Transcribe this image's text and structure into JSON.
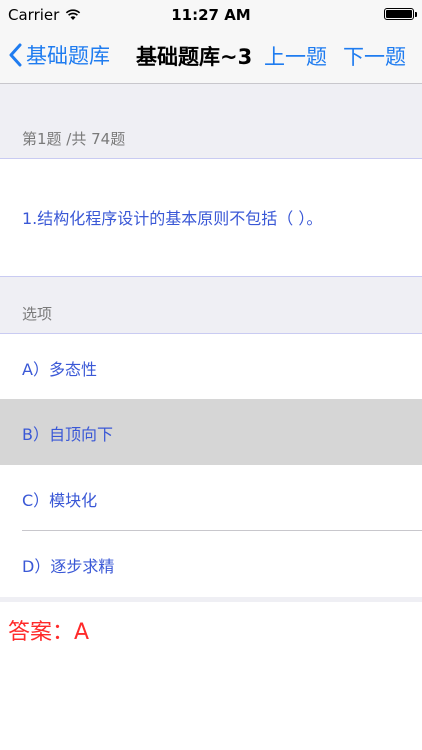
{
  "status_bar": {
    "carrier": "Carrier",
    "time": "11:27 AM",
    "battery_level_fraction": 1.0
  },
  "nav": {
    "back_label": "基础题库",
    "title": "基础题库~3",
    "prev_label": "上一题",
    "next_label": "下一题"
  },
  "question": {
    "counter": "第1题 /共 74题",
    "text": "1.结构化程序设计的基本原则不包括（  ）。"
  },
  "options_header": "选项",
  "options": [
    {
      "label": "A）多态性"
    },
    {
      "label": "B）自顶向下"
    },
    {
      "label": "C）模块化"
    },
    {
      "label": "D）逐步求精"
    }
  ],
  "answer": {
    "text": "答案：A"
  },
  "colors": {
    "accent": "#1f7cf0",
    "option_text": "#3a58d6",
    "answer": "#ff2a2a",
    "selected_bg": "#d6d6d6"
  }
}
